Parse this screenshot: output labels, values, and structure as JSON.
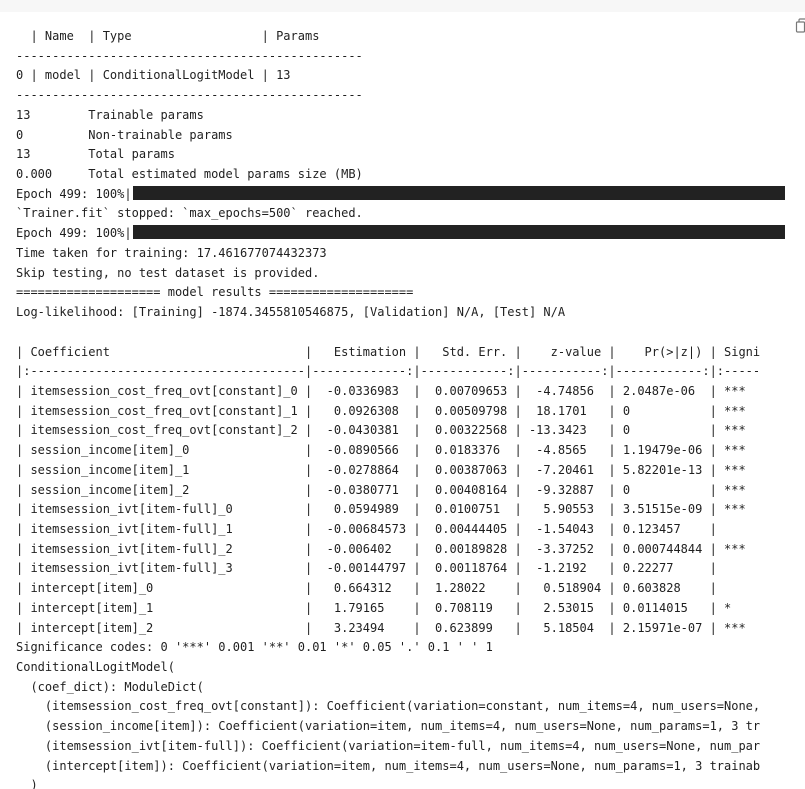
{
  "output": {
    "lines": [
      "  | Name  | Type                  | Params",
      "------------------------------------------------",
      "0 | model | ConditionalLogitModel | 13",
      "------------------------------------------------",
      "13        Trainable params",
      "0         Non-trainable params",
      "13        Total params",
      "0.000     Total estimated model params size (MB)"
    ],
    "progress": [
      {
        "label": "Epoch 499: 100%|",
        "percent": 100
      },
      {
        "label": "Epoch 499: 100%|",
        "percent": 100
      }
    ],
    "fit_message": "`Trainer.fit` stopped: `max_epochs=500` reached.",
    "after_lines": [
      "Time taken for training: 17.461677074432373",
      "Skip testing, no test dataset is provided.",
      "==================== model results ====================",
      "Log-likelihood: [Training] -1874.3455810546875, [Validation] N/A, [Test] N/A",
      "",
      "| Coefficient                           |   Estimation |   Std. Err. |    z-value |    Pr(>|z|) | Signi",
      "|:--------------------------------------|-------------:|------------:|-----------:|------------:|:-----",
      "| itemsession_cost_freq_ovt[constant]_0 |  -0.0336983  |  0.00709653 |  -4.74856  | 2.0487e-06  | ***",
      "| itemsession_cost_freq_ovt[constant]_1 |   0.0926308  |  0.00509798 |  18.1701   | 0           | ***",
      "| itemsession_cost_freq_ovt[constant]_2 |  -0.0430381  |  0.00322568 | -13.3423   | 0           | ***",
      "| session_income[item]_0                |  -0.0890566  |  0.0183376  |  -4.8565   | 1.19479e-06 | ***",
      "| session_income[item]_1                |  -0.0278864  |  0.00387063 |  -7.20461  | 5.82201e-13 | ***",
      "| session_income[item]_2                |  -0.0380771  |  0.00408164 |  -9.32887  | 0           | ***",
      "| itemsession_ivt[item-full]_0          |   0.0594989  |  0.0100751  |   5.90553  | 3.51515e-09 | ***",
      "| itemsession_ivt[item-full]_1          |  -0.00684573 |  0.00444405 |  -1.54043  | 0.123457    |",
      "| itemsession_ivt[item-full]_2          |  -0.006402   |  0.00189828 |  -3.37252  | 0.000744844 | ***",
      "| itemsession_ivt[item-full]_3          |  -0.00144797 |  0.00118764 |  -1.2192   | 0.22277     |",
      "| intercept[item]_0                     |   0.664312   |  1.28022    |   0.518904 | 0.603828    |",
      "| intercept[item]_1                     |   1.79165    |  0.708119   |   2.53015  | 0.0114015   | *",
      "| intercept[item]_2                     |   3.23494    |  0.623899   |   5.18504  | 2.15971e-07 | ***",
      "Significance codes: 0 '***' 0.001 '**' 0.01 '*' 0.05 '.' 0.1 ' ' 1",
      "ConditionalLogitModel(",
      "  (coef_dict): ModuleDict(",
      "    (itemsession_cost_freq_ovt[constant]): Coefficient(variation=constant, num_items=4, num_users=None,",
      "    (session_income[item]): Coefficient(variation=item, num_items=4, num_users=None, num_params=1, 3 tr",
      "    (itemsession_ivt[item-full]): Coefficient(variation=item-full, num_items=4, num_users=None, num_par",
      "    (intercept[item]): Coefficient(variation=item, num_items=4, num_users=None, num_params=1, 3 trainab",
      "  )"
    ]
  },
  "icons": {
    "copy": "copy-icon"
  }
}
